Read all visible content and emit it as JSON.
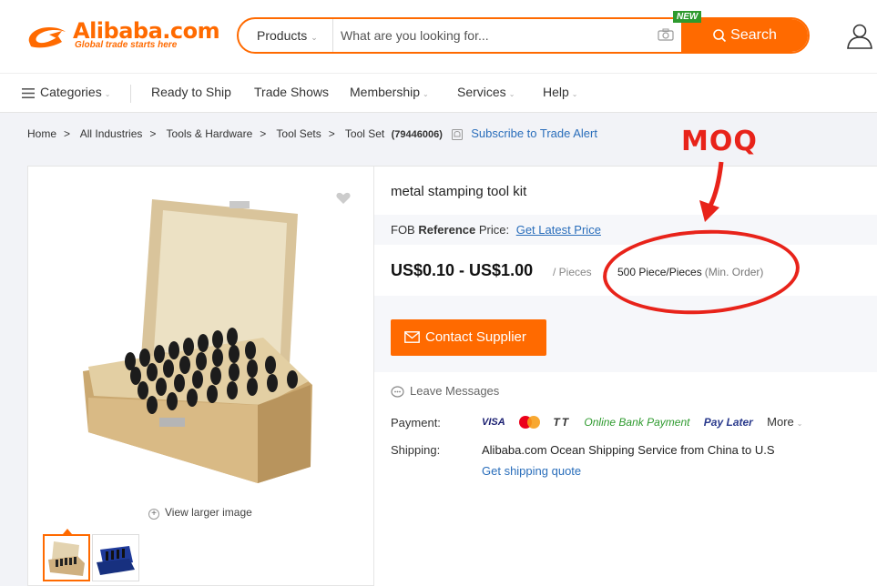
{
  "header": {
    "logo_text": "Alibaba.com",
    "logo_tagline": "Global trade starts here",
    "search": {
      "category": "Products",
      "placeholder": "What are you looking for...",
      "button_label": "Search",
      "new_badge": "NEW"
    },
    "brand_color": "#ff6a00",
    "user_icon": "user-icon"
  },
  "nav": {
    "items": [
      {
        "label": "Categories",
        "has_dropdown": true
      },
      {
        "label": "Ready to Ship",
        "has_dropdown": false
      },
      {
        "label": "Trade Shows",
        "has_dropdown": false
      },
      {
        "label": "Membership",
        "has_dropdown": true
      },
      {
        "label": "Services",
        "has_dropdown": true
      },
      {
        "label": "Help",
        "has_dropdown": true
      }
    ]
  },
  "breadcrumb": {
    "items": [
      "Home",
      "All Industries",
      "Tools & Hardware",
      "Tool Sets",
      "Tool Set"
    ],
    "separator": ">",
    "product_id": "(79446006)",
    "subscribe": "Subscribe to Trade Alert"
  },
  "gallery": {
    "view_larger": "View larger image",
    "thumbnail_count": 2,
    "selected_thumbnail": 1
  },
  "product": {
    "title": "metal stamping tool kit",
    "fob_prefix": "FOB",
    "fob_bold": "Reference",
    "fob_suffix": "Price:",
    "fob_link": "Get Latest Price",
    "price": "US$0.10 - US$1.00",
    "price_unit": "/ Pieces",
    "moq_value": "500 Piece/Pieces",
    "moq_label": "(Min. Order)",
    "contact_button": "Contact Supplier",
    "leave_messages": "Leave Messages",
    "payment_label": "Payment:",
    "payment_methods": [
      "VISA",
      "TT",
      "Online Bank Payment",
      "Pay Later"
    ],
    "payment_more": "More",
    "shipping_label": "Shipping:",
    "shipping_text": "Alibaba.com Ocean Shipping Service from China to U.S",
    "shipping_link": "Get shipping quote"
  },
  "annotation": {
    "label": "MOQ",
    "color": "#e8231a"
  }
}
